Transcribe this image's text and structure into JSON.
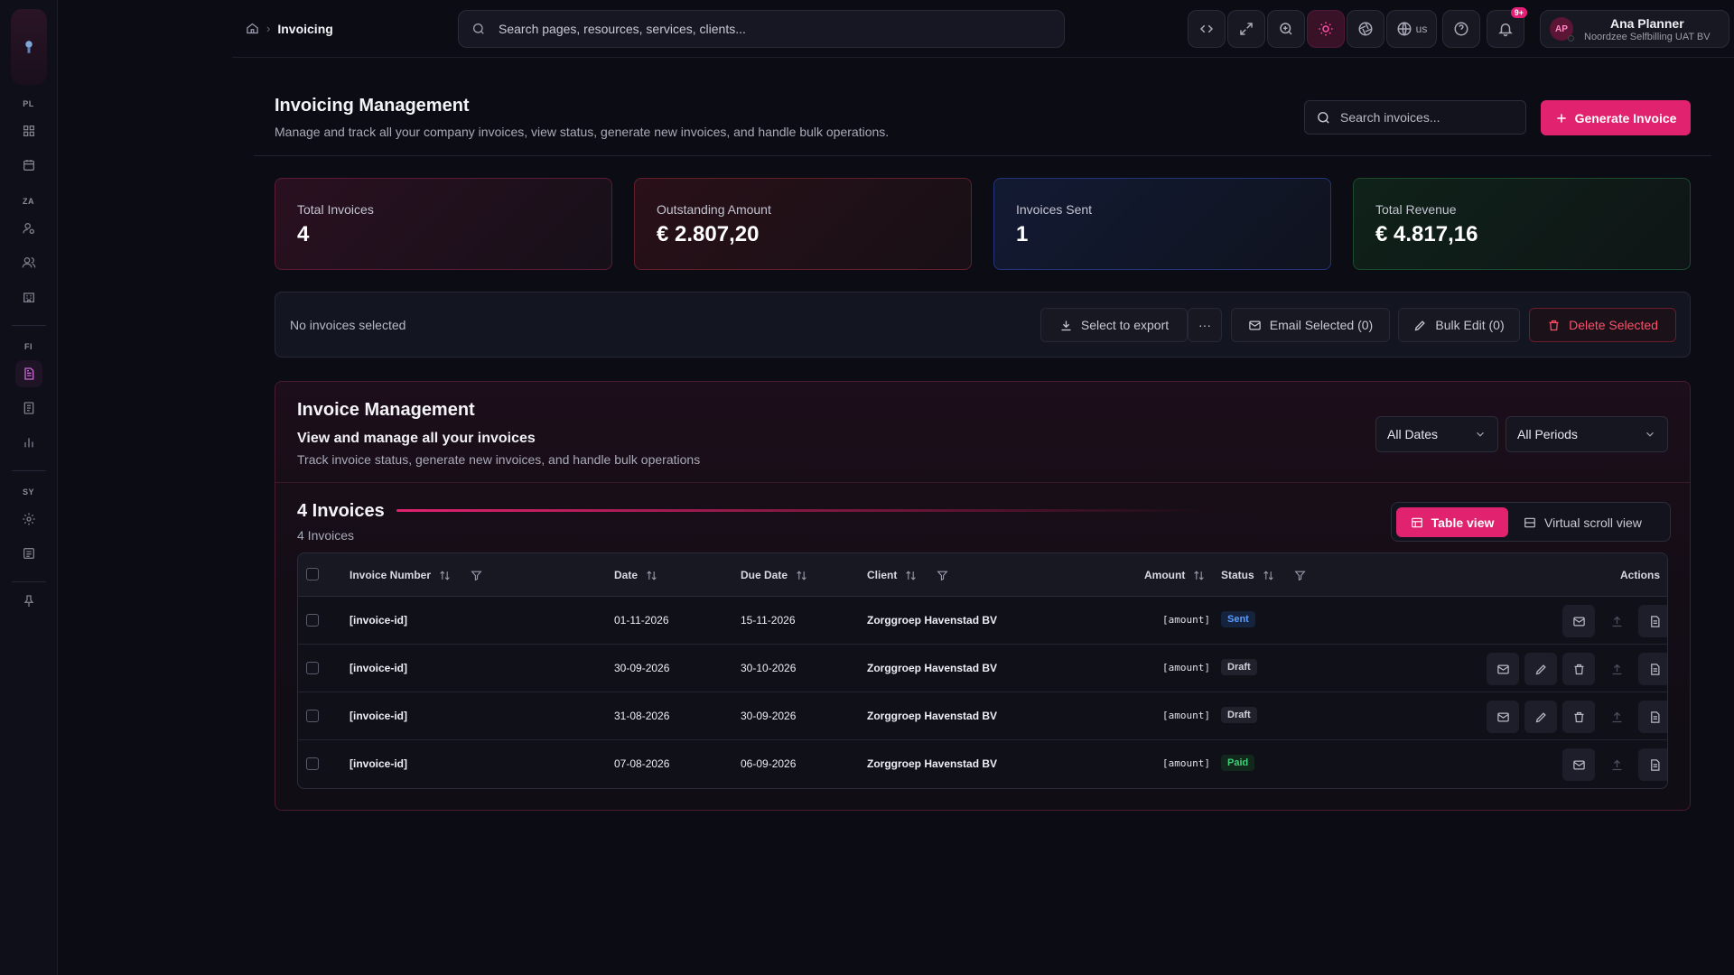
{
  "sidebar": {
    "sections": [
      "PL",
      "ZA",
      "FI",
      "SY"
    ]
  },
  "topbar": {
    "breadcrumb_current": "Invoicing",
    "search_placeholder": "Search pages, resources, services, clients...",
    "lang_code": "us",
    "notif_count": "9+",
    "user": {
      "initials": "AP",
      "name": "Ana Planner",
      "org": "Noordzee Selfbilling UAT BV"
    }
  },
  "header": {
    "title": "Invoicing Management",
    "subtitle": "Manage and track all your company invoices, view status, generate new invoices, and handle bulk operations.",
    "search_placeholder": "Search invoices...",
    "generate_label": "Generate Invoice"
  },
  "stats": [
    {
      "label": "Total Invoices",
      "value": "4"
    },
    {
      "label": "Outstanding Amount",
      "value": "€ 2.807,20"
    },
    {
      "label": "Invoices Sent",
      "value": "1"
    },
    {
      "label": "Total Revenue",
      "value": "€ 4.817,16"
    }
  ],
  "bulk": {
    "status": "No invoices selected",
    "export_label": "Select to export",
    "more_label": "···",
    "email_label": "Email Selected (0)",
    "edit_label": "Bulk Edit (0)",
    "delete_label": "Delete Selected"
  },
  "panel": {
    "title": "Invoice Management",
    "subtitle": "View and manage all your invoices",
    "description": "Track invoice status, generate new invoices, and handle bulk operations",
    "date_filter": "All Dates",
    "period_filter": "All Periods",
    "count_title": "4 Invoices",
    "count_sub": "4 Invoices",
    "table_view_label": "Table view",
    "virtual_view_label": "Virtual scroll view"
  },
  "table": {
    "columns": {
      "invoice_number": "Invoice Number",
      "date": "Date",
      "due_date": "Due Date",
      "client": "Client",
      "amount": "Amount",
      "status": "Status",
      "actions": "Actions"
    },
    "rows": [
      {
        "invoice": "[invoice-id]",
        "date": "01-11-2026",
        "due": "15-11-2026",
        "client": "Zorggroep Havenstad BV",
        "amount": "[amount]",
        "status": "Sent"
      },
      {
        "invoice": "[invoice-id]",
        "date": "30-09-2026",
        "due": "30-10-2026",
        "client": "Zorggroep Havenstad BV",
        "amount": "[amount]",
        "status": "Draft"
      },
      {
        "invoice": "[invoice-id]",
        "date": "31-08-2026",
        "due": "30-09-2026",
        "client": "Zorggroep Havenstad BV",
        "amount": "[amount]",
        "status": "Draft"
      },
      {
        "invoice": "[invoice-id]",
        "date": "07-08-2026",
        "due": "06-09-2026",
        "client": "Zorggroep Havenstad BV",
        "amount": "[amount]",
        "status": "Paid"
      }
    ]
  },
  "colors": {
    "accent": "#e0226f",
    "sent": "#5a9bff",
    "paid": "#3fd07a",
    "danger": "#ff4f6b"
  }
}
